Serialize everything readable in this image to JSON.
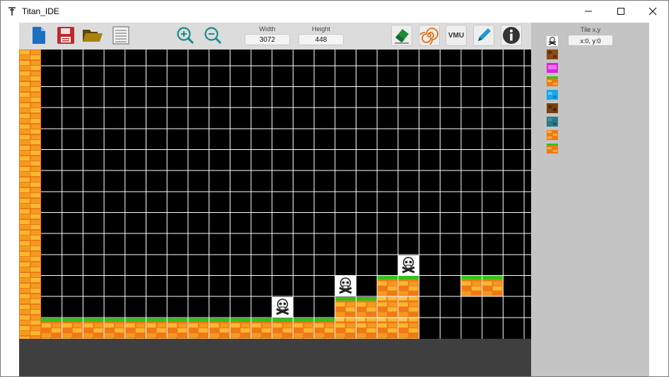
{
  "window": {
    "title": "Titan_IDE",
    "icon": "titan-logo-icon",
    "controls": [
      "minimize-icon",
      "maximize-icon",
      "close-icon"
    ]
  },
  "toolbar": {
    "buttons_left": [
      "new-file-icon",
      "save-icon",
      "open-folder-icon",
      "list-icon"
    ],
    "zoom_buttons": [
      "zoom-in-icon",
      "zoom-out-icon"
    ],
    "width_label": "Width",
    "width_value": "3072",
    "height_label": "Height",
    "height_value": "448",
    "tool_buttons": [
      "eraser-icon",
      "swirl-icon",
      "vmu-icon",
      "pencil-icon",
      "info-icon"
    ],
    "vmu_label": "VMU"
  },
  "side_panel": {
    "tile_label": "Tile x,y",
    "tile_value": "x:0, y:0",
    "palette": [
      "skull-tile",
      "dirt-tile",
      "pink-crystal-tile",
      "grass-brick-tile",
      "water-tile",
      "dirt-dark-tile",
      "teal-tile",
      "brick-tile",
      "grass-brick-tile-2"
    ]
  },
  "colors": {
    "brick_orange": "#f07818",
    "brick_yellow": "#f8b830",
    "grass": "#38c018",
    "grid_line": "#ffffff",
    "map_bg": "#000000",
    "panel": "#c4c4c4",
    "toolbar": "#dcdcdc",
    "statusbar": "#3f3f3f"
  }
}
